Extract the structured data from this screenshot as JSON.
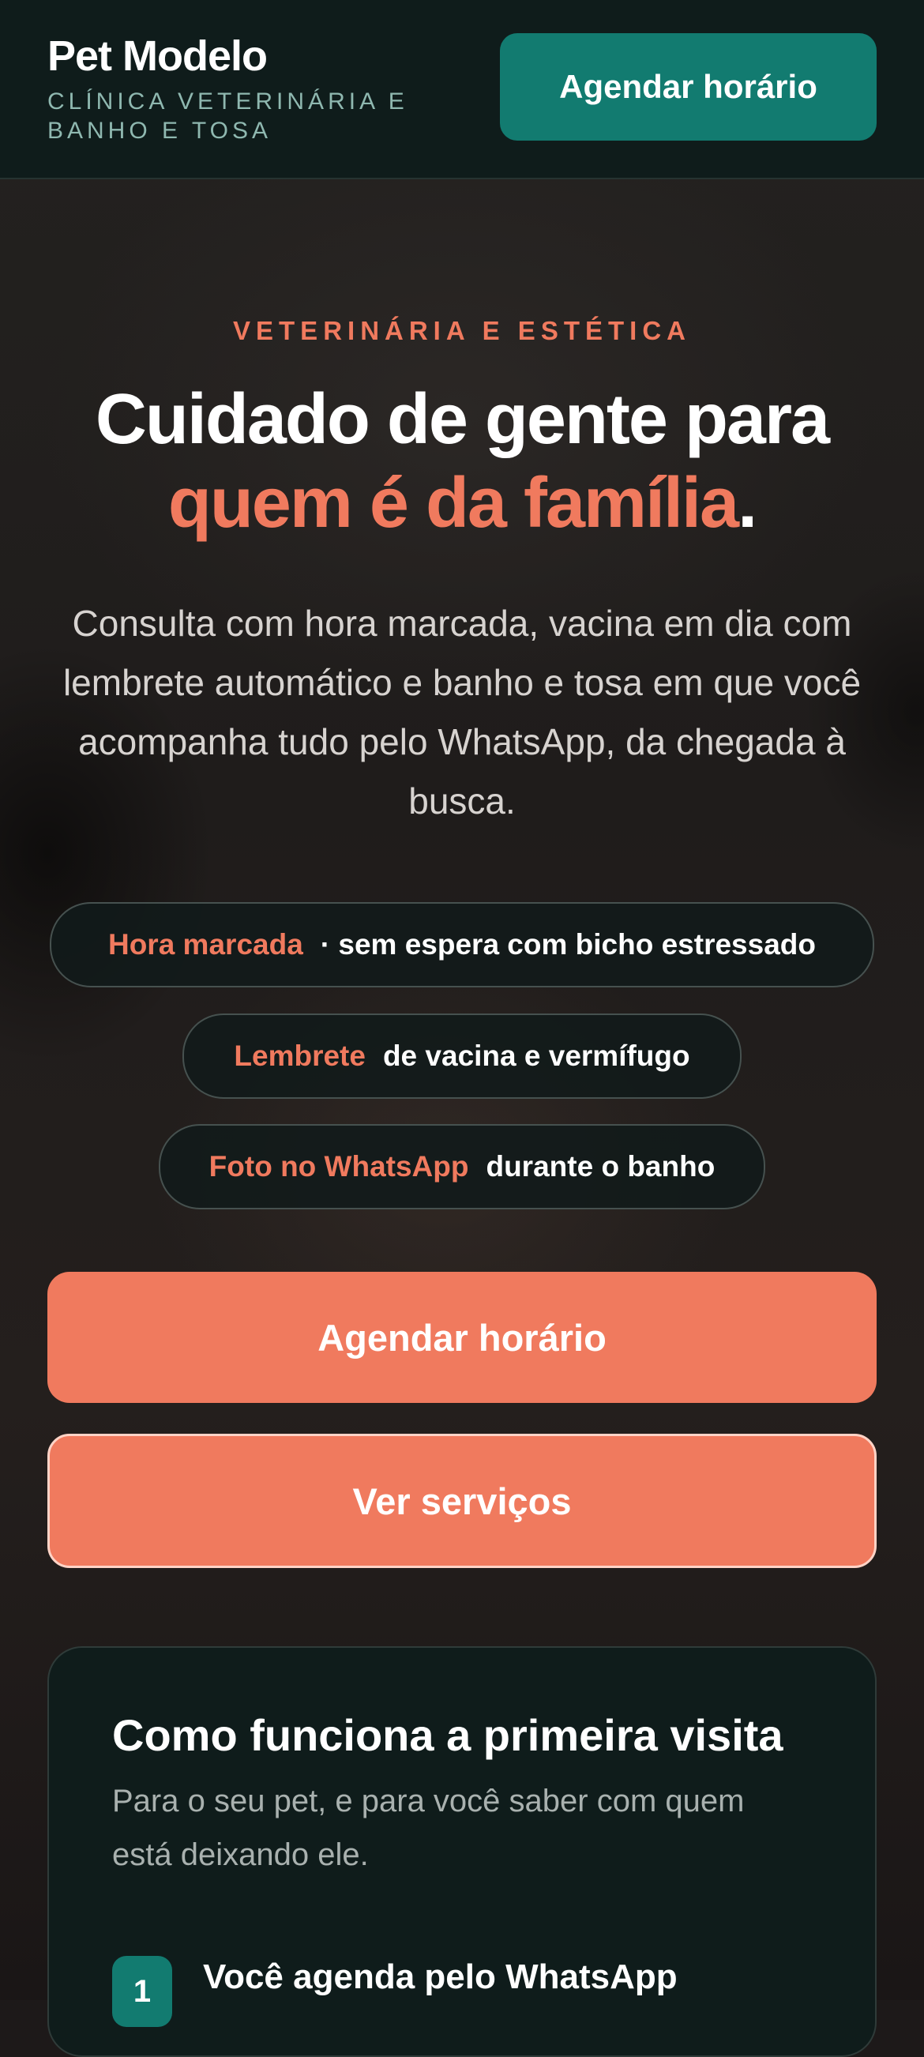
{
  "header": {
    "brand_name": "Pet Modelo",
    "brand_tagline": "CLÍNICA VETERINÁRIA E BANHO E TOSA",
    "cta_label": "Agendar horário"
  },
  "hero": {
    "eyebrow": "VETERINÁRIA E ESTÉTICA",
    "headline_line1": "Cuidado de gente para",
    "headline_accent": "quem é da família",
    "headline_end": ".",
    "lead": "Consulta com hora marcada, vacina em dia com lembrete automático e banho e tosa em que você acompanha tudo pelo WhatsApp, da chegada à busca.",
    "pills": [
      {
        "highlight": "Hora marcada",
        "text": "· sem espera com bicho estressado"
      },
      {
        "highlight": "Lembrete",
        "text": "de vacina e vermífugo"
      },
      {
        "highlight": "Foto no WhatsApp",
        "text": "durante o banho"
      }
    ],
    "primary_button": "Agendar horário",
    "secondary_button": "Ver serviços"
  },
  "first_visit": {
    "title": "Como funciona a primeira visita",
    "subtitle": "Para o seu pet, e para você saber com quem está deixando ele.",
    "steps": [
      {
        "number": "1",
        "title": "Você agenda pelo WhatsApp"
      }
    ]
  },
  "colors": {
    "header_bg": "#0f1c1b",
    "teal_accent": "#127b70",
    "coral_accent": "#f07a5e",
    "tagline": "#8fb8b0"
  }
}
